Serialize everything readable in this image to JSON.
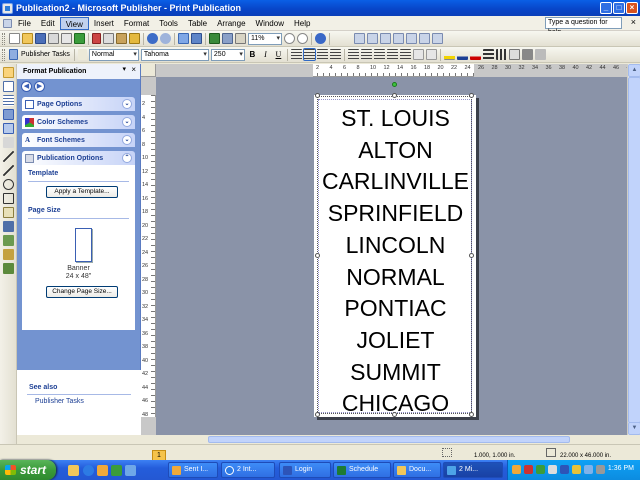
{
  "window": {
    "title": "Publication2 - Microsoft Publisher - Print Publication",
    "buttons": {
      "minimize": "_",
      "maximize": "□",
      "close": "×"
    }
  },
  "menubar": {
    "items": [
      "File",
      "Edit",
      "View",
      "Insert",
      "Format",
      "Tools",
      "Table",
      "Arrange",
      "Window",
      "Help"
    ],
    "active": "View",
    "help_placeholder": "Type a question for help",
    "close_glyph": "×"
  },
  "toolbar2": {
    "publisher_tasks": "Publisher Tasks",
    "style": "Normal",
    "font": "Tahoma",
    "size": "250",
    "bold": "B",
    "italic": "I",
    "underline": "U"
  },
  "toolbar1": {
    "zoom": "11%"
  },
  "taskpane": {
    "title": "Format Publication",
    "sections": [
      {
        "label": "Page Options",
        "icon": "page-options-icon"
      },
      {
        "label": "Color Schemes",
        "icon": "color-schemes-icon"
      },
      {
        "label": "Font Schemes",
        "icon": "font-schemes-icon"
      },
      {
        "label": "Publication Options",
        "icon": "publication-options-icon"
      }
    ],
    "template_title": "Template",
    "apply_template": "Apply a Template...",
    "page_size_title": "Page Size",
    "banner_name": "Banner",
    "banner_size": "24 x 48\"",
    "change_page_size": "Change Page Size...",
    "see_also": "See also",
    "publisher_tasks_link": "Publisher Tasks"
  },
  "ruler": {
    "h_labels": [
      "2",
      "4",
      "6",
      "8",
      "10",
      "12",
      "14",
      "16",
      "18",
      "20",
      "22",
      "24",
      "26",
      "28",
      "30",
      "32",
      "34",
      "36",
      "38",
      "40",
      "42",
      "44",
      "46",
      "48"
    ],
    "v_labels": [
      "2",
      "4",
      "6",
      "8",
      "10",
      "12",
      "14",
      "16",
      "18",
      "20",
      "22",
      "24",
      "26",
      "28",
      "30",
      "32",
      "34",
      "36",
      "38",
      "40",
      "42",
      "44",
      "46",
      "48"
    ]
  },
  "page": {
    "cities": [
      "ST. LOUIS",
      "ALTON",
      "CARLINVILLE",
      "SPRINFIELD",
      "LINCOLN",
      "NORMAL",
      "PONTIAC",
      "JOLIET",
      "SUMMIT",
      "CHICAGO"
    ]
  },
  "status": {
    "page_number": "1",
    "position": "1.000, 1.000 in.",
    "size": "22.000 x 46.000 in."
  },
  "taskbar": {
    "start": "start",
    "tasks": [
      {
        "label": "Sent I...",
        "icon": "outlook-icon"
      },
      {
        "label": "2 Int...",
        "icon": "ie-icon"
      },
      {
        "label": "Login",
        "icon": "login-icon"
      },
      {
        "label": "Schedule",
        "icon": "excel-icon"
      },
      {
        "label": "Docu...",
        "icon": "folder-icon"
      },
      {
        "label": "2 Mi...",
        "icon": "publisher-icon"
      }
    ],
    "clock": "1:36 PM"
  },
  "colors": {
    "titlebar": "#0846C9",
    "taskpane": "#7393D0",
    "workspace": "#8A93A8",
    "taskbar": "#245DDB"
  }
}
